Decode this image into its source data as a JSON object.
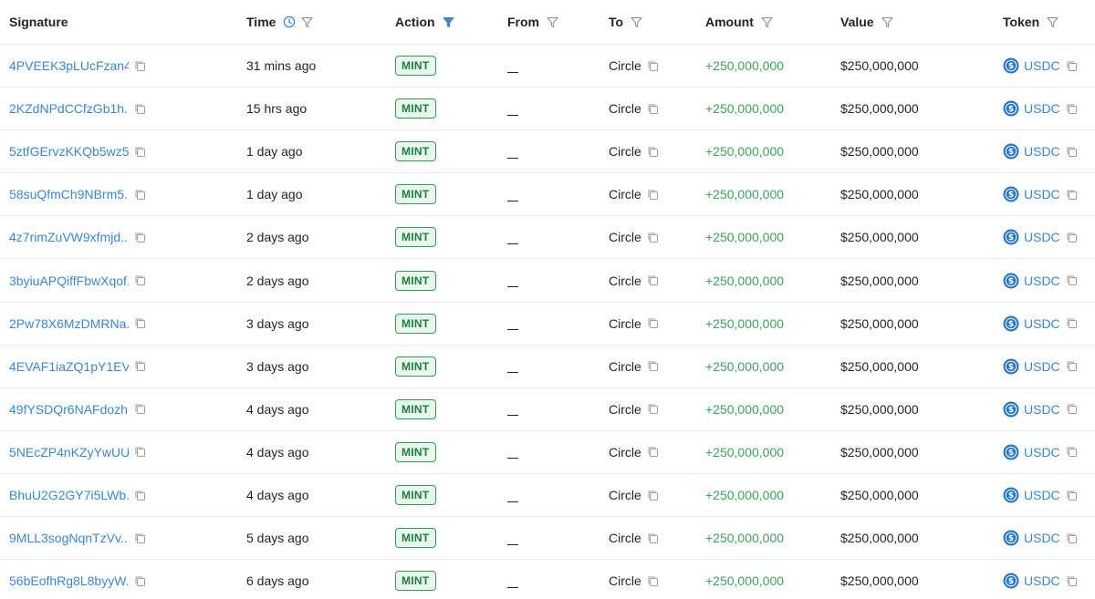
{
  "header": {
    "signature": "Signature",
    "time": "Time",
    "action": "Action",
    "from": "From",
    "to": "To",
    "amount": "Amount",
    "value": "Value",
    "token": "Token"
  },
  "colors": {
    "link": "#3a86d4",
    "amount_positive": "#3aa35a",
    "badge_border": "#2f9e55",
    "badge_bg": "#eaf7ee",
    "active_filter": "#3a86d4"
  },
  "icons": {
    "clock": "clock-icon",
    "filter": "filter-icon",
    "filter_active": "filter-active-icon",
    "copy": "copy-icon",
    "usdc": "usdc-token-icon"
  },
  "rows": [
    {
      "signature": "4PVEEK3pLUcFzan4...",
      "time": "31 mins ago",
      "action": "MINT",
      "from": "__",
      "to": "Circle",
      "amount": "+250,000,000",
      "value": "$250,000,000",
      "token": "USDC"
    },
    {
      "signature": "2KZdNPdCCfzGb1h...",
      "time": "15 hrs ago",
      "action": "MINT",
      "from": "__",
      "to": "Circle",
      "amount": "+250,000,000",
      "value": "$250,000,000",
      "token": "USDC"
    },
    {
      "signature": "5ztfGErvzKKQb5wz5...",
      "time": "1 day ago",
      "action": "MINT",
      "from": "__",
      "to": "Circle",
      "amount": "+250,000,000",
      "value": "$250,000,000",
      "token": "USDC"
    },
    {
      "signature": "58suQfmCh9NBrm5...",
      "time": "1 day ago",
      "action": "MINT",
      "from": "__",
      "to": "Circle",
      "amount": "+250,000,000",
      "value": "$250,000,000",
      "token": "USDC"
    },
    {
      "signature": "4z7rimZuVW9xfmjd...",
      "time": "2 days ago",
      "action": "MINT",
      "from": "__",
      "to": "Circle",
      "amount": "+250,000,000",
      "value": "$250,000,000",
      "token": "USDC"
    },
    {
      "signature": "3byiuAPQiffFbwXqof...",
      "time": "2 days ago",
      "action": "MINT",
      "from": "__",
      "to": "Circle",
      "amount": "+250,000,000",
      "value": "$250,000,000",
      "token": "USDC"
    },
    {
      "signature": "2Pw78X6MzDMRNa...",
      "time": "3 days ago",
      "action": "MINT",
      "from": "__",
      "to": "Circle",
      "amount": "+250,000,000",
      "value": "$250,000,000",
      "token": "USDC"
    },
    {
      "signature": "4EVAF1iaZQ1pY1EV...",
      "time": "3 days ago",
      "action": "MINT",
      "from": "__",
      "to": "Circle",
      "amount": "+250,000,000",
      "value": "$250,000,000",
      "token": "USDC"
    },
    {
      "signature": "49fYSDQr6NAFdozh...",
      "time": "4 days ago",
      "action": "MINT",
      "from": "__",
      "to": "Circle",
      "amount": "+250,000,000",
      "value": "$250,000,000",
      "token": "USDC"
    },
    {
      "signature": "5NEcZP4nKZyYwUU...",
      "time": "4 days ago",
      "action": "MINT",
      "from": "__",
      "to": "Circle",
      "amount": "+250,000,000",
      "value": "$250,000,000",
      "token": "USDC"
    },
    {
      "signature": "BhuU2G2GY7i5LWb...",
      "time": "4 days ago",
      "action": "MINT",
      "from": "__",
      "to": "Circle",
      "amount": "+250,000,000",
      "value": "$250,000,000",
      "token": "USDC"
    },
    {
      "signature": "9MLL3sogNqnTzVv...",
      "time": "5 days ago",
      "action": "MINT",
      "from": "__",
      "to": "Circle",
      "amount": "+250,000,000",
      "value": "$250,000,000",
      "token": "USDC"
    },
    {
      "signature": "56bEofhRg8L8byyW...",
      "time": "6 days ago",
      "action": "MINT",
      "from": "__",
      "to": "Circle",
      "amount": "+250,000,000",
      "value": "$250,000,000",
      "token": "USDC"
    }
  ]
}
